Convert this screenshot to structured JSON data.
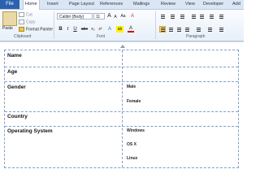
{
  "tabs": [
    {
      "label": "File"
    },
    {
      "label": "Home"
    },
    {
      "label": "Insert"
    },
    {
      "label": "Page Layout"
    },
    {
      "label": "References"
    },
    {
      "label": "Mailings"
    },
    {
      "label": "Review"
    },
    {
      "label": "View"
    },
    {
      "label": "Developer"
    },
    {
      "label": "Add"
    }
  ],
  "ribbon": {
    "clipboard": {
      "paste": "Paste",
      "cut": "Cut",
      "copy": "Copy",
      "format_painter": "Format Painter",
      "group": "Clipboard"
    },
    "font": {
      "name": "Calibri (Body)",
      "size": "11",
      "grow": "A",
      "shrink": "A",
      "bold": "B",
      "italic": "I",
      "underline": "U",
      "strike": "abe",
      "subscript": "x₂",
      "superscript": "x²",
      "effects": "A",
      "highlight": "ab",
      "color": "A",
      "clear": "A",
      "group": "Font"
    },
    "paragraph": {
      "group": "Paragraph"
    }
  },
  "table": {
    "rows": [
      {
        "label": "Name",
        "values": []
      },
      {
        "label": "Age",
        "values": []
      },
      {
        "label": "Gender",
        "values": [
          "Male",
          "Female"
        ]
      },
      {
        "label": "Country",
        "values": []
      },
      {
        "label": "Operating System",
        "values": [
          "Windows",
          "OS X",
          "Linux"
        ]
      }
    ]
  },
  "colors": {
    "file_tab": "#2a62b0",
    "gridline": "#7f9fce",
    "active_align": "#f7d77c"
  }
}
